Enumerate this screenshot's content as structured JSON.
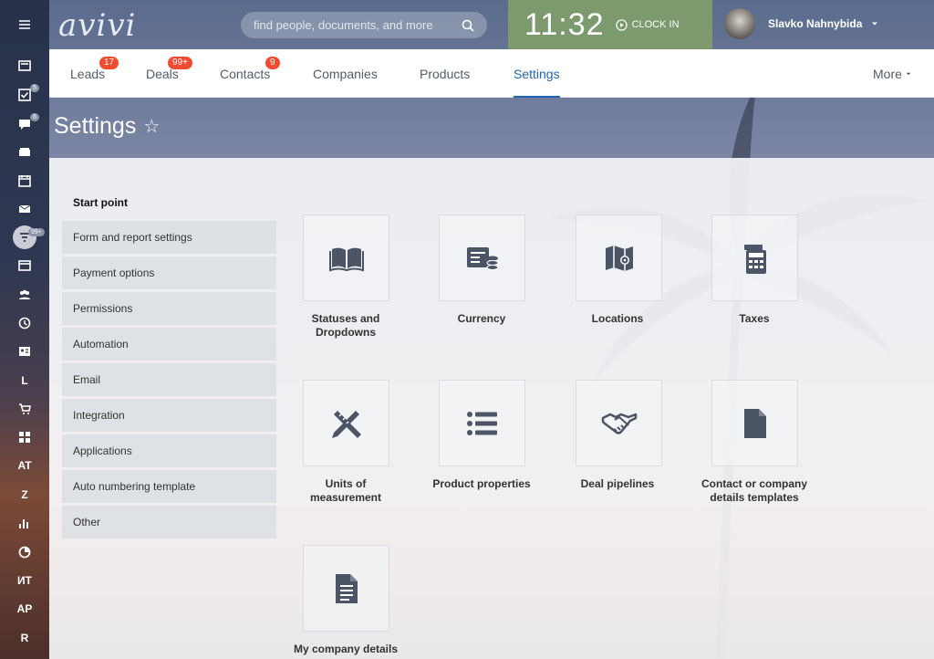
{
  "app": {
    "logo": "avivi"
  },
  "search": {
    "placeholder": "find people, documents, and more"
  },
  "clock": {
    "time": "11:32",
    "clock_in": "CLOCK IN"
  },
  "user": {
    "name": "Slavko Nahnybida"
  },
  "sidebar": {
    "badges": {
      "tasks": "5",
      "chat": "6",
      "feed": "99+"
    },
    "text_items": [
      "L",
      "AT",
      "Z",
      "ИТ",
      "AP",
      "R"
    ]
  },
  "nav": {
    "tabs": [
      {
        "label": "Leads",
        "count": "17"
      },
      {
        "label": "Deals",
        "count": "99+"
      },
      {
        "label": "Contacts",
        "count": "9"
      },
      {
        "label": "Companies"
      },
      {
        "label": "Products"
      },
      {
        "label": "Settings"
      }
    ],
    "more": "More"
  },
  "page": {
    "title": "Settings"
  },
  "settings": {
    "start_point": "Start point",
    "menu": [
      "Form and report settings",
      "Payment options",
      "Permissions",
      "Automation",
      "Email",
      "Integration",
      "Applications",
      "Auto numbering template",
      "Other"
    ],
    "tiles": [
      {
        "label": "Statuses and\nDropdowns",
        "icon": "book-icon"
      },
      {
        "label": "Currency",
        "icon": "currency-icon"
      },
      {
        "label": "Locations",
        "icon": "map-icon"
      },
      {
        "label": "Taxes",
        "icon": "calculator-icon"
      },
      {
        "label": "Units of\nmeasurement",
        "icon": "ruler-pencil-icon"
      },
      {
        "label": "Product properties",
        "icon": "list-icon"
      },
      {
        "label": "Deal pipelines",
        "icon": "handshake-icon"
      },
      {
        "label": "Contact or company\ndetails templates",
        "icon": "file-icon"
      },
      {
        "label": "My company details",
        "icon": "document-icon"
      }
    ]
  },
  "colors": {
    "accent": "#2067b0",
    "badge": "#f14c30",
    "clock_bg": "#7d9a6f",
    "icon": "#4b5566"
  }
}
